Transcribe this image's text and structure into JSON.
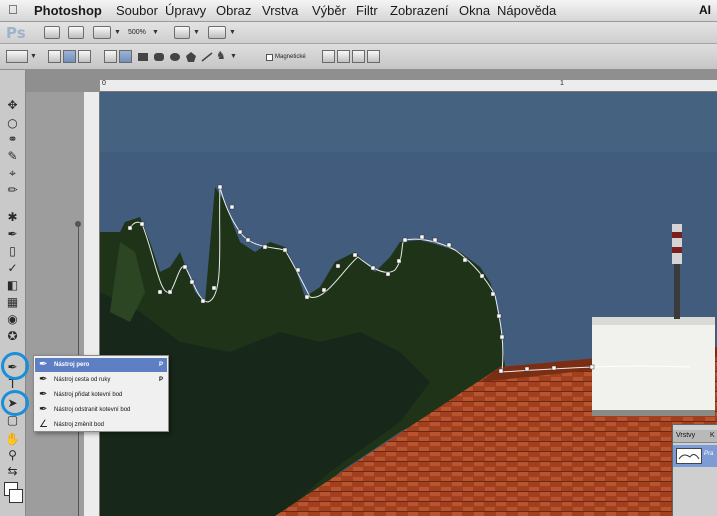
{
  "menubar": {
    "app": "Photoshop",
    "items": [
      "Soubor",
      "Úpravy",
      "Obraz",
      "Vrstva",
      "Výběr",
      "Filtr",
      "Zobrazení",
      "Okna",
      "Nápověda"
    ],
    "right_label": "AI"
  },
  "appbar": {
    "logo": "Ps",
    "zoom": "500%"
  },
  "options": {
    "magnetic_label": "Magnetické"
  },
  "ruler": {
    "marks": [
      "0",
      "1"
    ]
  },
  "flyout": {
    "items": [
      {
        "label": "Nástroj pero",
        "key": "P",
        "selected": true
      },
      {
        "label": "Nástroj cesta od ruky",
        "key": "P",
        "selected": false
      },
      {
        "label": "Nástroj přidat kotevní bod",
        "key": "",
        "selected": false
      },
      {
        "label": "Nástroj odstranit kotevní bod",
        "key": "",
        "selected": false
      },
      {
        "label": "Nástroj změnit bod",
        "key": "",
        "selected": false
      }
    ]
  },
  "layers_panel": {
    "tab_layers": "Vrstvy",
    "tab_other": "K",
    "row_label": "Pra"
  },
  "colors": {
    "highlight_ring": "#1a8fd8",
    "selection": "#5f7fc4",
    "sky": "#3f5a7a",
    "roof": "#9a3a1e"
  }
}
